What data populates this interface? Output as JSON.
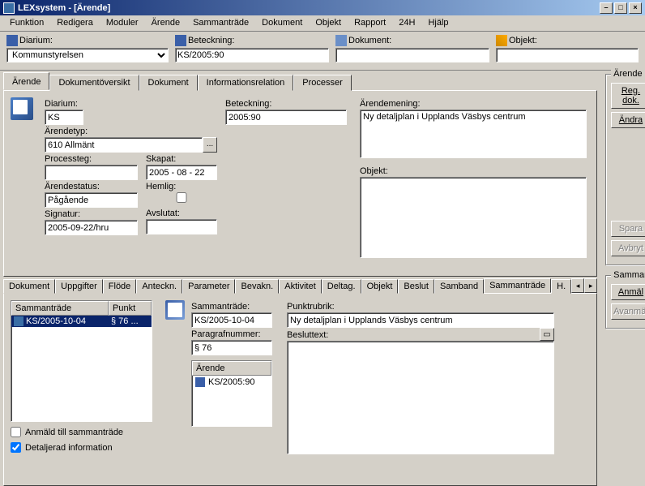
{
  "window": {
    "title": "LEXsystem - [Ärende]"
  },
  "menu": [
    "Funktion",
    "Redigera",
    "Moduler",
    "Ärende",
    "Sammanträde",
    "Dokument",
    "Objekt",
    "Rapport",
    "24H",
    "Hjälp"
  ],
  "search": {
    "diarium": {
      "label": "Diarium:",
      "value": "Kommunstyrelsen"
    },
    "beteckning": {
      "label": "Beteckning:",
      "value": "KS/2005:90"
    },
    "dokument": {
      "label": "Dokument:",
      "value": ""
    },
    "objekt": {
      "label": "Objekt:",
      "value": ""
    }
  },
  "upper_tabs": [
    "Ärende",
    "Dokumentöversikt",
    "Dokument",
    "Informationsrelation",
    "Processer"
  ],
  "arende_form": {
    "diarium": {
      "label": "Diarium:",
      "value": "KS"
    },
    "beteckning": {
      "label": "Beteckning:",
      "value": "2005:90"
    },
    "arendetyp": {
      "label": "Ärendetyp:",
      "value": "610 Allmänt"
    },
    "processteg": {
      "label": "Processteg:",
      "value": ""
    },
    "skapat": {
      "label": "Skapat:",
      "value": "2005 - 08 - 22"
    },
    "arendestatus": {
      "label": "Ärendestatus:",
      "value": "Pågående"
    },
    "hemlig": {
      "label": "Hemlig:",
      "checked": false
    },
    "signatur": {
      "label": "Signatur:",
      "value": "2005-09-22/hru"
    },
    "avslutat": {
      "label": "Avslutat:",
      "value": ""
    },
    "arendemening": {
      "label": "Ärendemening:",
      "value": "Ny detaljplan i Upplands Väsbys centrum"
    },
    "objekt": {
      "label": "Objekt:",
      "value": ""
    }
  },
  "right_buttons": {
    "group": "Ärende",
    "regdok": "Reg. dok.",
    "andra": "Ändra",
    "spara": "Spara",
    "avbryt": "Avbryt",
    "group2": "Sammanträde",
    "anmal": "Anmäl",
    "avanmal": "Avanmäl"
  },
  "lower_tabs": [
    "Dokument",
    "Uppgifter",
    "Flöde",
    "Anteckn.",
    "Parameter",
    "Bevakn.",
    "Aktivitet",
    "Deltag.",
    "Objekt",
    "Beslut",
    "Samband",
    "Sammanträde",
    "H."
  ],
  "lower_active": "Sammanträde",
  "lower": {
    "list": {
      "col1": "Sammanträde",
      "col2": "Punkt",
      "row_date": "KS/2005-10-04",
      "row_punkt": "§ 76 ..."
    },
    "sammantrade": {
      "label": "Sammanträde:",
      "value": "KS/2005-10-04"
    },
    "paragraf": {
      "label": "Paragrafnummer:",
      "value": "§ 76"
    },
    "arende_box": {
      "title": "Ärende",
      "item": "KS/2005:90"
    },
    "punktrubrik": {
      "label": "Punktrubrik:",
      "value": "Ny detaljplan i Upplands Väsbys centrum"
    },
    "besluttext": {
      "label": "Besluttext:",
      "value": ""
    },
    "chk1": "Anmäld till sammanträde",
    "chk2": "Detaljerad information"
  }
}
